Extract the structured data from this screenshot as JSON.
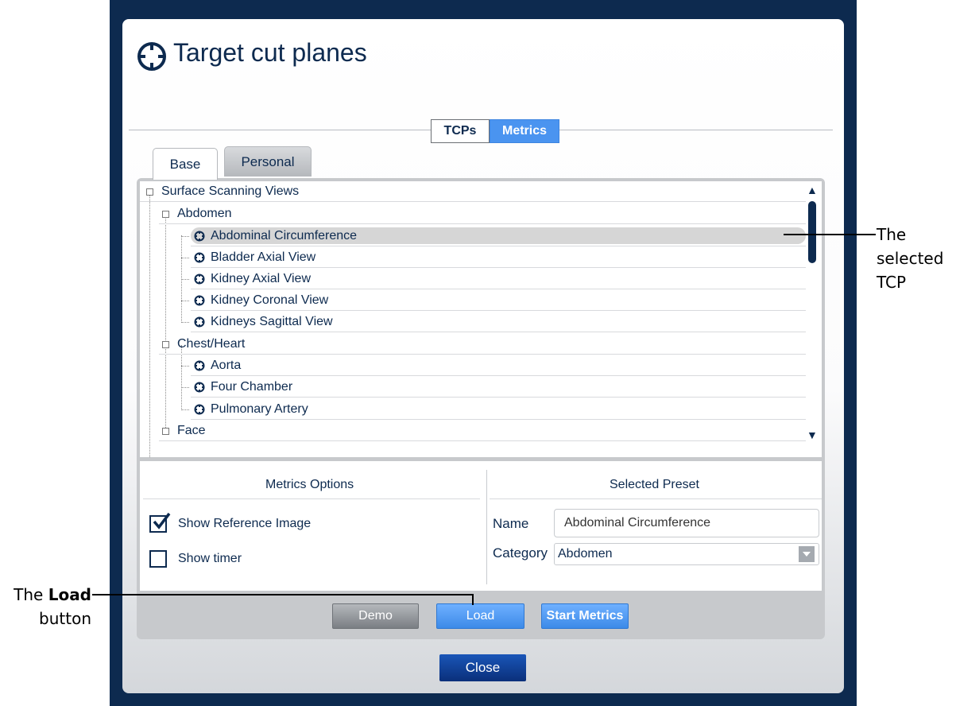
{
  "dialog": {
    "title": "Target cut planes",
    "icon": "target-icon"
  },
  "mode_toggle": {
    "tcps_label": "TCPs",
    "metrics_label": "Metrics",
    "selected": "TCPs"
  },
  "tabs": {
    "base_label": "Base",
    "personal_label": "Personal",
    "active": "Base"
  },
  "tree": {
    "root": "Surface Scanning Views",
    "abdomen": "Abdomen",
    "abdomen_items": [
      "Abdominal Circumference",
      "Bladder Axial View",
      "Kidney Axial View",
      "Kidney Coronal View",
      "Kidneys Sagittal View"
    ],
    "chest": "Chest/Heart",
    "chest_items": [
      "Aorta",
      "Four Chamber",
      "Pulmonary Artery"
    ],
    "face": "Face",
    "selected_item": "Abdominal Circumference",
    "scroll_up": "▲",
    "scroll_down": "▼"
  },
  "metrics_options": {
    "title": "Metrics Options",
    "show_reference_label": "Show Reference Image",
    "show_reference_checked": true,
    "show_timer_label": "Show timer",
    "show_timer_checked": false
  },
  "selected_preset": {
    "title": "Selected Preset",
    "name_label": "Name",
    "name_value": "Abdominal Circumference",
    "category_label": "Category",
    "category_value": "Abdomen"
  },
  "buttons": {
    "demo": "Demo",
    "load": "Load",
    "start_metrics": "Start Metrics",
    "close": "Close"
  },
  "annotations": {
    "selected_tcp_line1": "The",
    "selected_tcp_line2": "selected",
    "selected_tcp_line3": "TCP",
    "load_prefix": "The ",
    "load_bold": "Load",
    "load_line2": "button"
  },
  "colors": {
    "frame": "#0d2a4f",
    "accent": "#4a94f0",
    "close_button": "#0a2f7a"
  }
}
